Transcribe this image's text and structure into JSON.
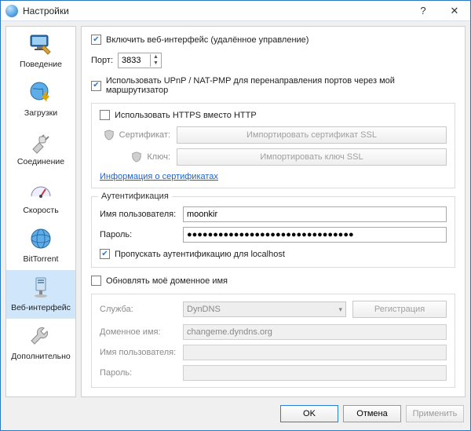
{
  "window": {
    "title": "Настройки",
    "help": "?",
    "close": "✕"
  },
  "sidebar": {
    "items": [
      {
        "label": "Поведение"
      },
      {
        "label": "Загрузки"
      },
      {
        "label": "Соединение"
      },
      {
        "label": "Скорость"
      },
      {
        "label": "BitTorrent"
      },
      {
        "label": "Веб-интерфейс"
      },
      {
        "label": "Дополнительно"
      }
    ]
  },
  "main": {
    "enable_web": "Включить веб-интерфейс (удалённое управление)",
    "port_label": "Порт:",
    "port_value": "3833",
    "upnp": "Использовать UPnP / NAT-PMP для перенаправления портов через мой маршрутизатор",
    "https": "Использовать HTTPS вместо HTTP",
    "cert_label": "Сертификат:",
    "cert_btn": "Импортировать сертификат SSL",
    "key_label": "Ключ:",
    "key_btn": "Импортировать ключ SSL",
    "cert_info": "Информация о сертификатах",
    "auth_legend": "Аутентификация",
    "user_label": "Имя пользователя:",
    "user_value": "moonkir",
    "pass_label": "Пароль:",
    "pass_value": "●●●●●●●●●●●●●●●●●●●●●●●●●●●●●●●●",
    "bypass_local": "Пропускать аутентификацию для localhost",
    "dyn_enable": "Обновлять моё доменное имя",
    "service_label": "Служба:",
    "service_value": "DynDNS",
    "register_btn": "Регистрация",
    "domain_label": "Доменное имя:",
    "domain_value": "changeme.dyndns.org",
    "dyn_user_label": "Имя пользователя:",
    "dyn_pass_label": "Пароль:"
  },
  "footer": {
    "ok": "OK",
    "cancel": "Отмена",
    "apply": "Применить"
  }
}
